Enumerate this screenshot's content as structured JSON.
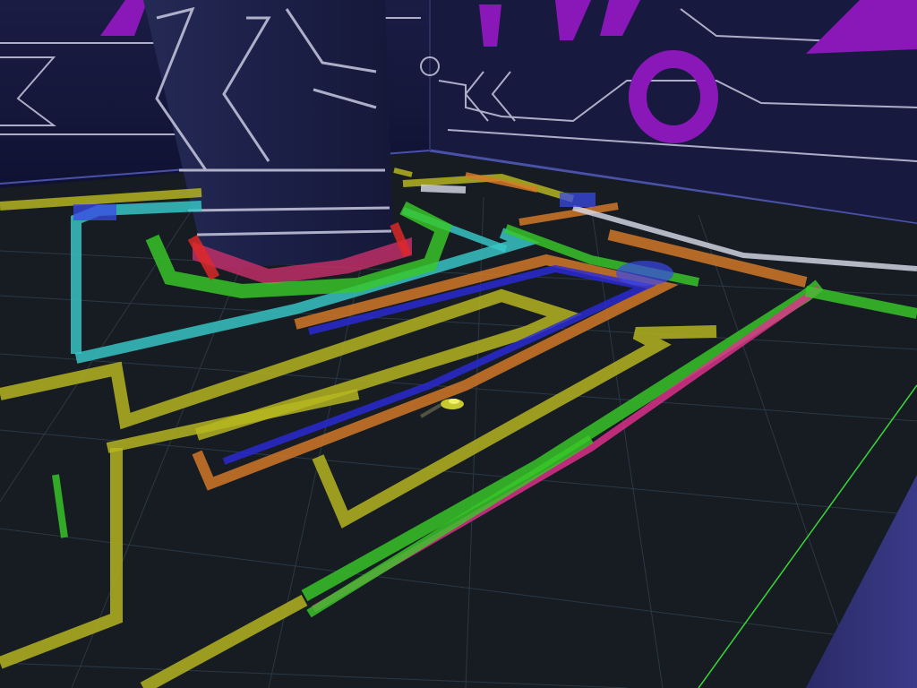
{
  "scene": {
    "colors": {
      "sky_wall": "#1a1c40",
      "wall_dark": "#121330",
      "floor": "#161c22",
      "grid": "#3a4a5a",
      "pillar": "#1d2146",
      "purple_accent": "#8a18b8",
      "wall_lines": "#c8c8e0",
      "yellow_wall": "#b8b820",
      "orange_wall": "#d87a28",
      "blue_wall": "#2a2ad8",
      "cyan_wall": "#38c8c8",
      "green_wall": "#38c828",
      "magenta_wall": "#e0308c",
      "red_wall": "#e02828",
      "white_wall": "#d8d8e8",
      "player_car": "#c8c830"
    },
    "objects": [
      "arena-back-wall",
      "central-pillar",
      "maze-wall-segments",
      "boost-pads",
      "player-car"
    ]
  }
}
